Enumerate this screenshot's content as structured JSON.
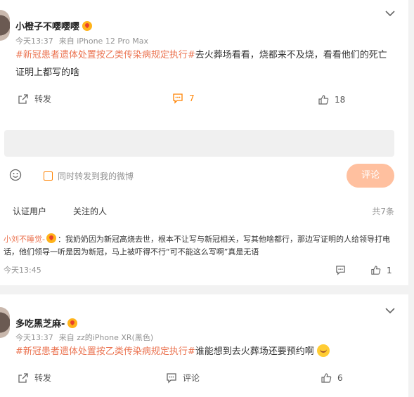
{
  "post1": {
    "author": "小橙子不嘤嘤嘤",
    "time": "今天13:37",
    "source": "来自 iPhone 12 Pro Max",
    "topic": "#新冠患者遗体处置按乙类传染病规定执行#",
    "text": "去火葬场看看，烧都来不及烧，看看他们的死亡证明上都写的啥",
    "forward_label": "转发",
    "comment_count": "7",
    "like_count": "18"
  },
  "composer": {
    "sync_label": "同时转发到我的微博",
    "submit_label": "评论"
  },
  "comments_panel": {
    "tabs": [
      "认证用户",
      "关注的人"
    ],
    "total": "共7条",
    "comment": {
      "author": "小刘不睡觉-",
      "text": "：我奶奶因为新冠高烧去世，根本不让写与新冠相关，写其他啥都行，那边写证明的人给领导打电话，他们领导一听是因为新冠，马上被吓得不行“可不能这么写啊”真是无语",
      "time": "今天13:45",
      "like_count": "1"
    }
  },
  "post2": {
    "author": "多吃黑芝麻-",
    "time": "今天13:37",
    "source": "来自 zz的iPhone XR(黑色)",
    "topic": "#新冠患者遗体处置按乙类传染病规定执行#",
    "text": "谁能想到去火葬场还要预约啊",
    "forward_label": "转发",
    "comment_label": "评论",
    "like_count": "6"
  },
  "colors": {
    "accent": "#ff8200",
    "topic": "#eb7350",
    "submit_disabled": "#ffc09f",
    "background": "#f2f2f2"
  }
}
